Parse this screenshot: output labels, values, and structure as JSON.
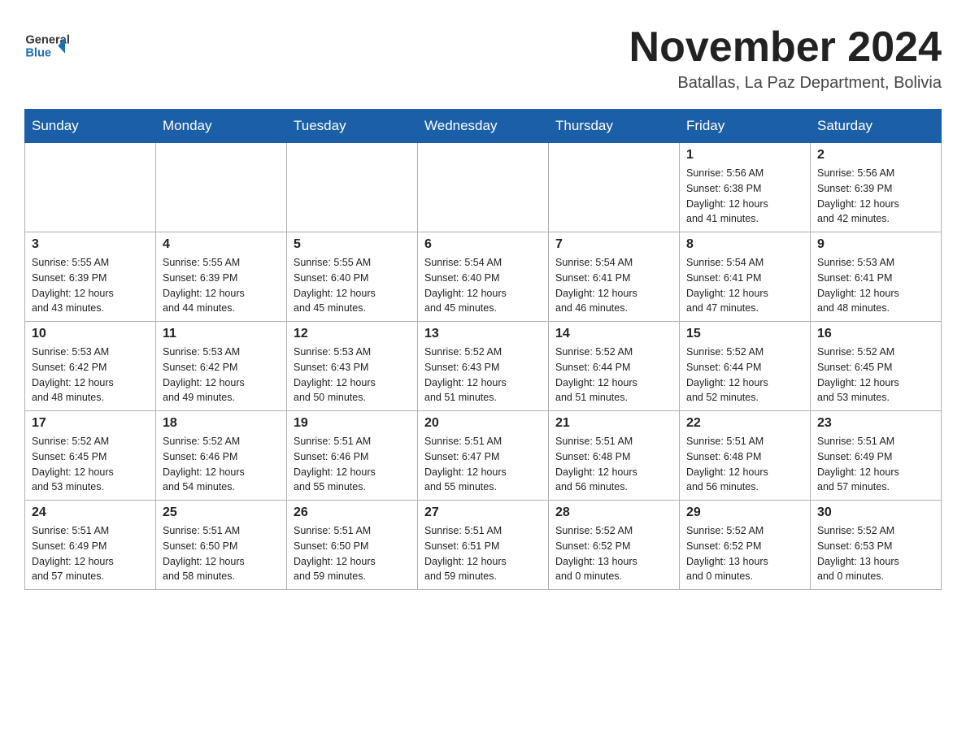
{
  "header": {
    "logo_general": "General",
    "logo_blue": "Blue",
    "month_title": "November 2024",
    "location": "Batallas, La Paz Department, Bolivia"
  },
  "days_of_week": [
    "Sunday",
    "Monday",
    "Tuesday",
    "Wednesday",
    "Thursday",
    "Friday",
    "Saturday"
  ],
  "weeks": [
    [
      {
        "day": "",
        "info": ""
      },
      {
        "day": "",
        "info": ""
      },
      {
        "day": "",
        "info": ""
      },
      {
        "day": "",
        "info": ""
      },
      {
        "day": "",
        "info": ""
      },
      {
        "day": "1",
        "info": "Sunrise: 5:56 AM\nSunset: 6:38 PM\nDaylight: 12 hours\nand 41 minutes."
      },
      {
        "day": "2",
        "info": "Sunrise: 5:56 AM\nSunset: 6:39 PM\nDaylight: 12 hours\nand 42 minutes."
      }
    ],
    [
      {
        "day": "3",
        "info": "Sunrise: 5:55 AM\nSunset: 6:39 PM\nDaylight: 12 hours\nand 43 minutes."
      },
      {
        "day": "4",
        "info": "Sunrise: 5:55 AM\nSunset: 6:39 PM\nDaylight: 12 hours\nand 44 minutes."
      },
      {
        "day": "5",
        "info": "Sunrise: 5:55 AM\nSunset: 6:40 PM\nDaylight: 12 hours\nand 45 minutes."
      },
      {
        "day": "6",
        "info": "Sunrise: 5:54 AM\nSunset: 6:40 PM\nDaylight: 12 hours\nand 45 minutes."
      },
      {
        "day": "7",
        "info": "Sunrise: 5:54 AM\nSunset: 6:41 PM\nDaylight: 12 hours\nand 46 minutes."
      },
      {
        "day": "8",
        "info": "Sunrise: 5:54 AM\nSunset: 6:41 PM\nDaylight: 12 hours\nand 47 minutes."
      },
      {
        "day": "9",
        "info": "Sunrise: 5:53 AM\nSunset: 6:41 PM\nDaylight: 12 hours\nand 48 minutes."
      }
    ],
    [
      {
        "day": "10",
        "info": "Sunrise: 5:53 AM\nSunset: 6:42 PM\nDaylight: 12 hours\nand 48 minutes."
      },
      {
        "day": "11",
        "info": "Sunrise: 5:53 AM\nSunset: 6:42 PM\nDaylight: 12 hours\nand 49 minutes."
      },
      {
        "day": "12",
        "info": "Sunrise: 5:53 AM\nSunset: 6:43 PM\nDaylight: 12 hours\nand 50 minutes."
      },
      {
        "day": "13",
        "info": "Sunrise: 5:52 AM\nSunset: 6:43 PM\nDaylight: 12 hours\nand 51 minutes."
      },
      {
        "day": "14",
        "info": "Sunrise: 5:52 AM\nSunset: 6:44 PM\nDaylight: 12 hours\nand 51 minutes."
      },
      {
        "day": "15",
        "info": "Sunrise: 5:52 AM\nSunset: 6:44 PM\nDaylight: 12 hours\nand 52 minutes."
      },
      {
        "day": "16",
        "info": "Sunrise: 5:52 AM\nSunset: 6:45 PM\nDaylight: 12 hours\nand 53 minutes."
      }
    ],
    [
      {
        "day": "17",
        "info": "Sunrise: 5:52 AM\nSunset: 6:45 PM\nDaylight: 12 hours\nand 53 minutes."
      },
      {
        "day": "18",
        "info": "Sunrise: 5:52 AM\nSunset: 6:46 PM\nDaylight: 12 hours\nand 54 minutes."
      },
      {
        "day": "19",
        "info": "Sunrise: 5:51 AM\nSunset: 6:46 PM\nDaylight: 12 hours\nand 55 minutes."
      },
      {
        "day": "20",
        "info": "Sunrise: 5:51 AM\nSunset: 6:47 PM\nDaylight: 12 hours\nand 55 minutes."
      },
      {
        "day": "21",
        "info": "Sunrise: 5:51 AM\nSunset: 6:48 PM\nDaylight: 12 hours\nand 56 minutes."
      },
      {
        "day": "22",
        "info": "Sunrise: 5:51 AM\nSunset: 6:48 PM\nDaylight: 12 hours\nand 56 minutes."
      },
      {
        "day": "23",
        "info": "Sunrise: 5:51 AM\nSunset: 6:49 PM\nDaylight: 12 hours\nand 57 minutes."
      }
    ],
    [
      {
        "day": "24",
        "info": "Sunrise: 5:51 AM\nSunset: 6:49 PM\nDaylight: 12 hours\nand 57 minutes."
      },
      {
        "day": "25",
        "info": "Sunrise: 5:51 AM\nSunset: 6:50 PM\nDaylight: 12 hours\nand 58 minutes."
      },
      {
        "day": "26",
        "info": "Sunrise: 5:51 AM\nSunset: 6:50 PM\nDaylight: 12 hours\nand 59 minutes."
      },
      {
        "day": "27",
        "info": "Sunrise: 5:51 AM\nSunset: 6:51 PM\nDaylight: 12 hours\nand 59 minutes."
      },
      {
        "day": "28",
        "info": "Sunrise: 5:52 AM\nSunset: 6:52 PM\nDaylight: 13 hours\nand 0 minutes."
      },
      {
        "day": "29",
        "info": "Sunrise: 5:52 AM\nSunset: 6:52 PM\nDaylight: 13 hours\nand 0 minutes."
      },
      {
        "day": "30",
        "info": "Sunrise: 5:52 AM\nSunset: 6:53 PM\nDaylight: 13 hours\nand 0 minutes."
      }
    ]
  ]
}
